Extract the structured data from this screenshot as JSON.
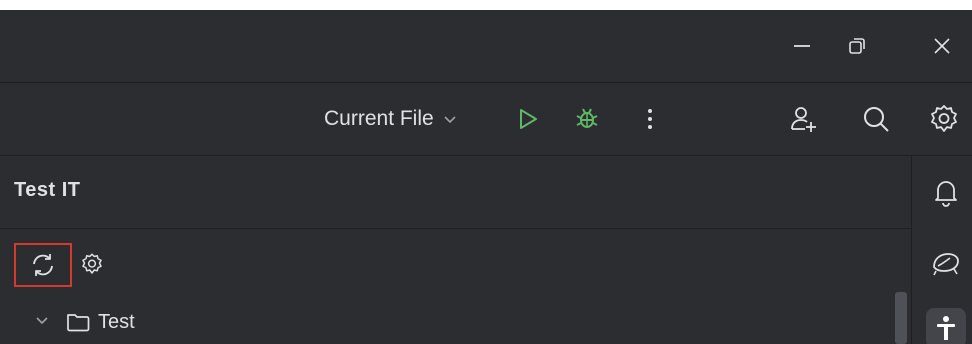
{
  "titlebar": {
    "icons": [
      "minimize-icon",
      "restore-icon",
      "close-icon"
    ]
  },
  "toolbar": {
    "run_config_label": "Current File",
    "icons": [
      "chevron-down-icon",
      "run-icon",
      "debug-icon",
      "more-icon",
      "add-user-icon",
      "search-icon",
      "settings-icon"
    ]
  },
  "panel": {
    "title": "Test IT",
    "actions": [
      "refresh-icon",
      "settings-icon"
    ],
    "tree": [
      {
        "label": "Test",
        "expanded": true,
        "icon": "folder-icon"
      }
    ]
  },
  "side_strip": {
    "icons": [
      "notifications-icon",
      "plugin-icon",
      "accessibility-icon"
    ]
  },
  "colors": {
    "background": "#2b2d30",
    "text": "#dfe1e5",
    "run_green": "#5fb865",
    "highlight_red": "#d23a2e"
  }
}
